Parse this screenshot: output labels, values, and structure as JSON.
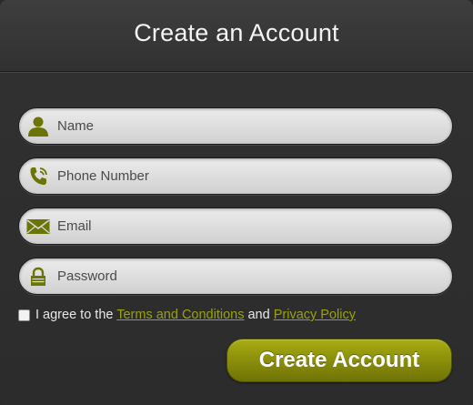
{
  "header": {
    "title": "Create an Account"
  },
  "form": {
    "fields": [
      {
        "placeholder": "Name",
        "icon": "user-icon"
      },
      {
        "placeholder": "Phone Number",
        "icon": "phone-icon"
      },
      {
        "placeholder": "Email",
        "icon": "envelope-icon"
      },
      {
        "placeholder": "Password",
        "icon": "lock-icon"
      }
    ],
    "agreement": {
      "prefix": "I agree to the ",
      "terms_link": "Terms and Conditions",
      "middle": " and ",
      "privacy_link": "Privacy Policy",
      "checked": false
    },
    "submit_label": "Create Account"
  },
  "colors": {
    "accent": "#8d910a",
    "icon": "#6b7505",
    "link": "#9aa10a"
  }
}
